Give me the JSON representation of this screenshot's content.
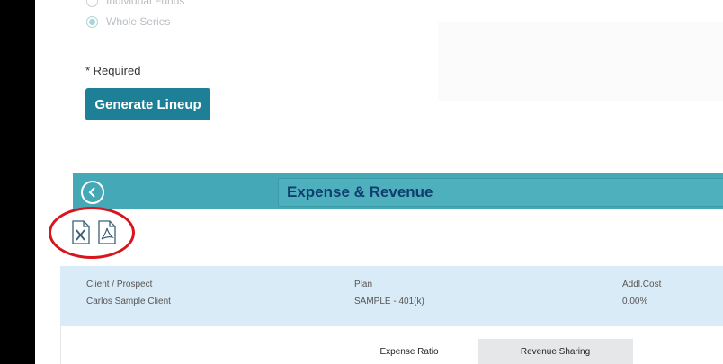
{
  "options": {
    "individual_funds": "Individual Funds",
    "whole_series": "Whole Series"
  },
  "required_note": "* Required",
  "generate_button": "Generate Lineup",
  "section": {
    "title": "Expense & Revenue"
  },
  "info": {
    "client_label": "Client / Prospect",
    "client_value": "Carlos Sample Client",
    "plan_label": "Plan",
    "plan_value": "SAMPLE - 401(k)",
    "cost_label": "Addl.Cost",
    "cost_value": "0.00%"
  },
  "table": {
    "columns": [
      "Expense Ratio",
      "Revenue Sharing"
    ]
  },
  "icons": {
    "excel": "excel-export-icon",
    "pdf": "pdf-export-icon",
    "back": "back-arrow-icon"
  },
  "colors": {
    "primary_button": "#1e8096",
    "header_band": "#45a8b6",
    "title_text": "#0f3d6e",
    "info_band": "#d9ebf7",
    "highlight_ring": "#d8151c"
  }
}
